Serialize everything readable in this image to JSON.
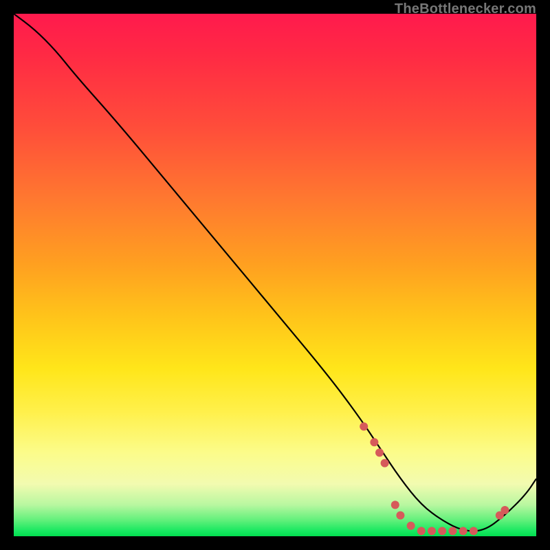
{
  "brand": "TheBottlenecker.com",
  "chart_data": {
    "type": "line",
    "title": "",
    "xlabel": "",
    "ylabel": "",
    "xlim": [
      0,
      100
    ],
    "ylim": [
      0,
      100
    ],
    "series": [
      {
        "name": "bottleneck-curve",
        "x": [
          0,
          4,
          8,
          12,
          20,
          30,
          40,
          50,
          60,
          66,
          70,
          74,
          78,
          82,
          86,
          90,
          94,
          98,
          100
        ],
        "y": [
          100,
          97,
          93,
          88,
          79,
          67,
          55,
          43,
          31,
          23,
          17,
          11,
          6,
          3,
          1,
          1,
          4,
          8,
          11
        ]
      }
    ],
    "markers": {
      "name": "highlight-dots",
      "points": [
        {
          "x": 67,
          "y": 21
        },
        {
          "x": 69,
          "y": 18
        },
        {
          "x": 70,
          "y": 16
        },
        {
          "x": 71,
          "y": 14
        },
        {
          "x": 73,
          "y": 6
        },
        {
          "x": 74,
          "y": 4
        },
        {
          "x": 76,
          "y": 2
        },
        {
          "x": 78,
          "y": 1
        },
        {
          "x": 80,
          "y": 1
        },
        {
          "x": 82,
          "y": 1
        },
        {
          "x": 84,
          "y": 1
        },
        {
          "x": 86,
          "y": 1
        },
        {
          "x": 88,
          "y": 1
        },
        {
          "x": 93,
          "y": 4
        },
        {
          "x": 94,
          "y": 5
        }
      ]
    }
  }
}
